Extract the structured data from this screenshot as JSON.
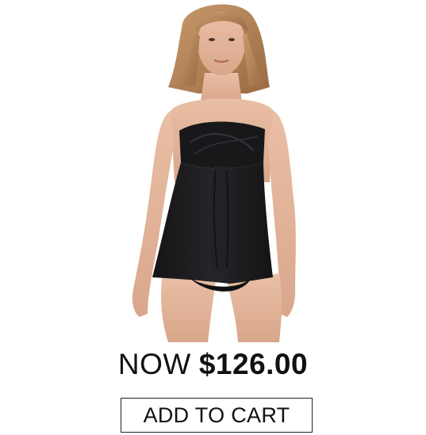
{
  "product": {
    "price_prefix": "NOW",
    "price": "$126.00",
    "add_to_cart_label": "ADD TO CART",
    "image_name": "black-bandeau-swim-dress-photo"
  },
  "colors": {
    "text": "#111111",
    "garment": "#1b1b1d",
    "background": "#ffffff",
    "button_border": "#222222"
  }
}
